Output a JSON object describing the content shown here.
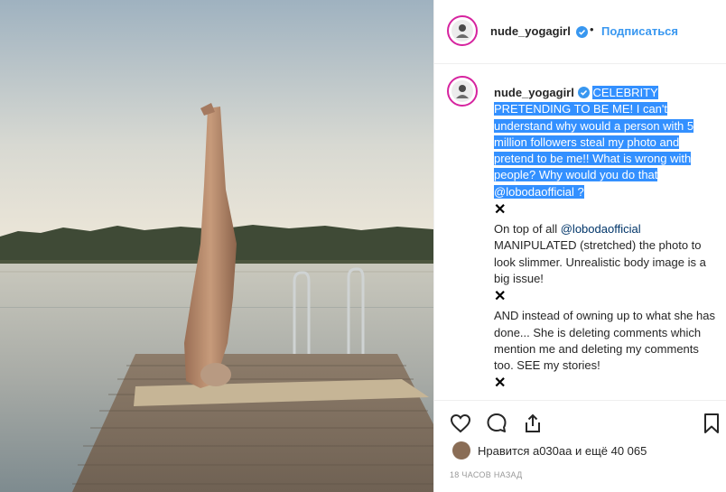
{
  "post": {
    "username": "nude_yogagirl",
    "follow_dot": "•",
    "follow_label": "Подписаться"
  },
  "caption": {
    "username": "nude_yogagirl",
    "highlighted": "CELEBRITY PRETENDING TO BE ME! I can't understand why would a person with 5 million followers steal my photo and pretend to be me!! What is wrong with people? Why would you do that",
    "highlighted_mention": "@lobodaofficial",
    "highlighted_tail": "?",
    "x1": "✕",
    "para2_before": "On top of all",
    "para2_mention": "@lobodaofficial",
    "para2_after": "MANIPULATED (stretched) the photo to look slimmer. Unrealistic body image is a big issue!",
    "x2": "✕",
    "para3": "AND instead of owning up to what she has done... She is deleting comments which mention me and deleting my comments too. SEE my stories!",
    "x3": "✕"
  },
  "icons": {
    "like": "heart-icon",
    "comment": "comment-icon",
    "share": "share-icon",
    "save": "bookmark-icon",
    "verified": "verified-badge-icon"
  },
  "likes": {
    "text": "Нравится a030aa и ещё 40 065"
  },
  "timestamp": "18 ЧАСОВ НАЗАД",
  "colors": {
    "accent": "#3897f0",
    "highlight": "#3390ff",
    "verified": "#3897f0",
    "ring": "#d6249f"
  }
}
